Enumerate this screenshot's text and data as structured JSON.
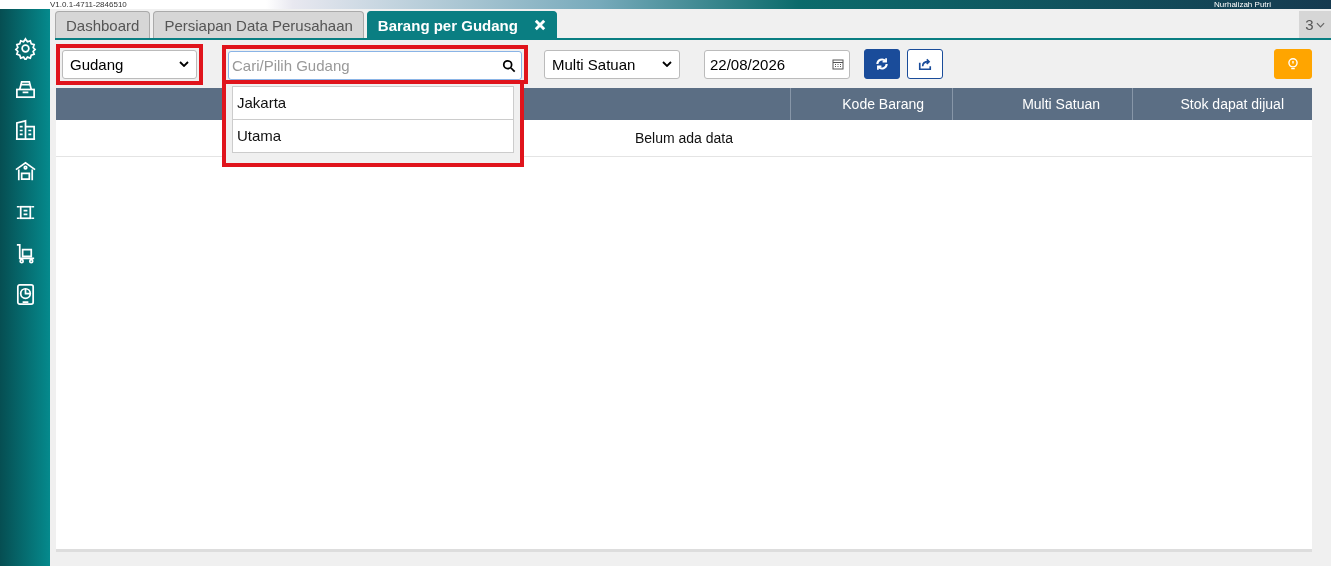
{
  "header": {
    "version": "V1.0.1-4711-2846510",
    "user": "Nurhalizah Putri"
  },
  "sidebar": {
    "items": [
      {
        "kind": "gear"
      },
      {
        "kind": "register"
      },
      {
        "kind": "building"
      },
      {
        "kind": "warehouse"
      },
      {
        "kind": "transfer"
      },
      {
        "kind": "cart"
      },
      {
        "kind": "report"
      }
    ]
  },
  "tabs": [
    {
      "label": "Dashboard",
      "selected": false,
      "closable": false
    },
    {
      "label": "Persiapan Data Perusahaan",
      "selected": false,
      "closable": false
    },
    {
      "label": "Barang per Gudang",
      "selected": true,
      "closable": true
    }
  ],
  "tab_count": "3",
  "toolbar": {
    "filter_type": {
      "value": "Gudang",
      "highlighted": true
    },
    "search": {
      "placeholder": "Cari/Pilih Gudang",
      "highlighted": true,
      "options": [
        "Jakarta",
        "Utama"
      ]
    },
    "unit_mode": {
      "value": "Multi Satuan"
    },
    "date": {
      "value": "22/08/2026"
    }
  },
  "table": {
    "columns": [
      "Kode Barang",
      "Multi Satuan",
      "Stok dapat dijual"
    ],
    "empty_text": "Belum ada data"
  }
}
